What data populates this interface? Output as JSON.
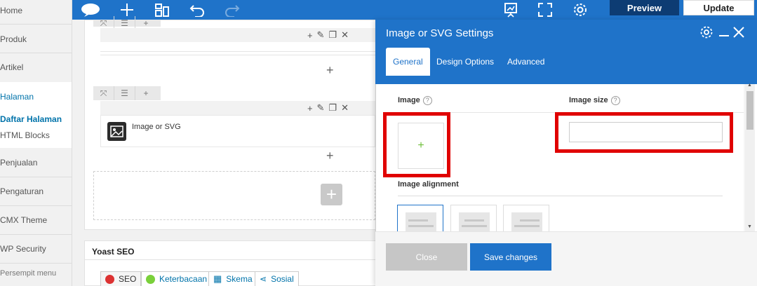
{
  "sidebar": {
    "items": [
      {
        "label": "Home"
      },
      {
        "label": "Produk"
      },
      {
        "label": "Artikel"
      },
      {
        "label": "Halaman"
      },
      {
        "label": "Daftar Halaman"
      },
      {
        "label": "HTML Blocks"
      },
      {
        "label": "Penjualan"
      },
      {
        "label": "Pengaturan"
      },
      {
        "label": "CMX Theme"
      },
      {
        "label": "WP Security"
      },
      {
        "label": "Persempit menu"
      }
    ]
  },
  "toolbar": {
    "preview_label": "Preview",
    "update_label": "Update"
  },
  "editor": {
    "element_label": "Image or SVG"
  },
  "yoast": {
    "title": "Yoast SEO",
    "tabs": [
      {
        "label": "SEO",
        "color": "#dc3232"
      },
      {
        "label": "Keterbacaan",
        "color": "#7ad03a"
      },
      {
        "label": "Skema",
        "color": "#0073aa"
      },
      {
        "label": "Sosial",
        "color": "#0073aa"
      }
    ]
  },
  "panel": {
    "title": "Image or SVG Settings",
    "tabs": [
      {
        "label": "General"
      },
      {
        "label": "Design Options"
      },
      {
        "label": "Advanced"
      }
    ],
    "image_label": "Image",
    "image_size_label": "Image size",
    "image_size_value": "",
    "alignment_label": "Image alignment",
    "close_label": "Close",
    "save_label": "Save changes"
  },
  "colors": {
    "accent": "#1f73c9",
    "highlight": "#e00000",
    "add_icon": "#6fbf3a"
  }
}
